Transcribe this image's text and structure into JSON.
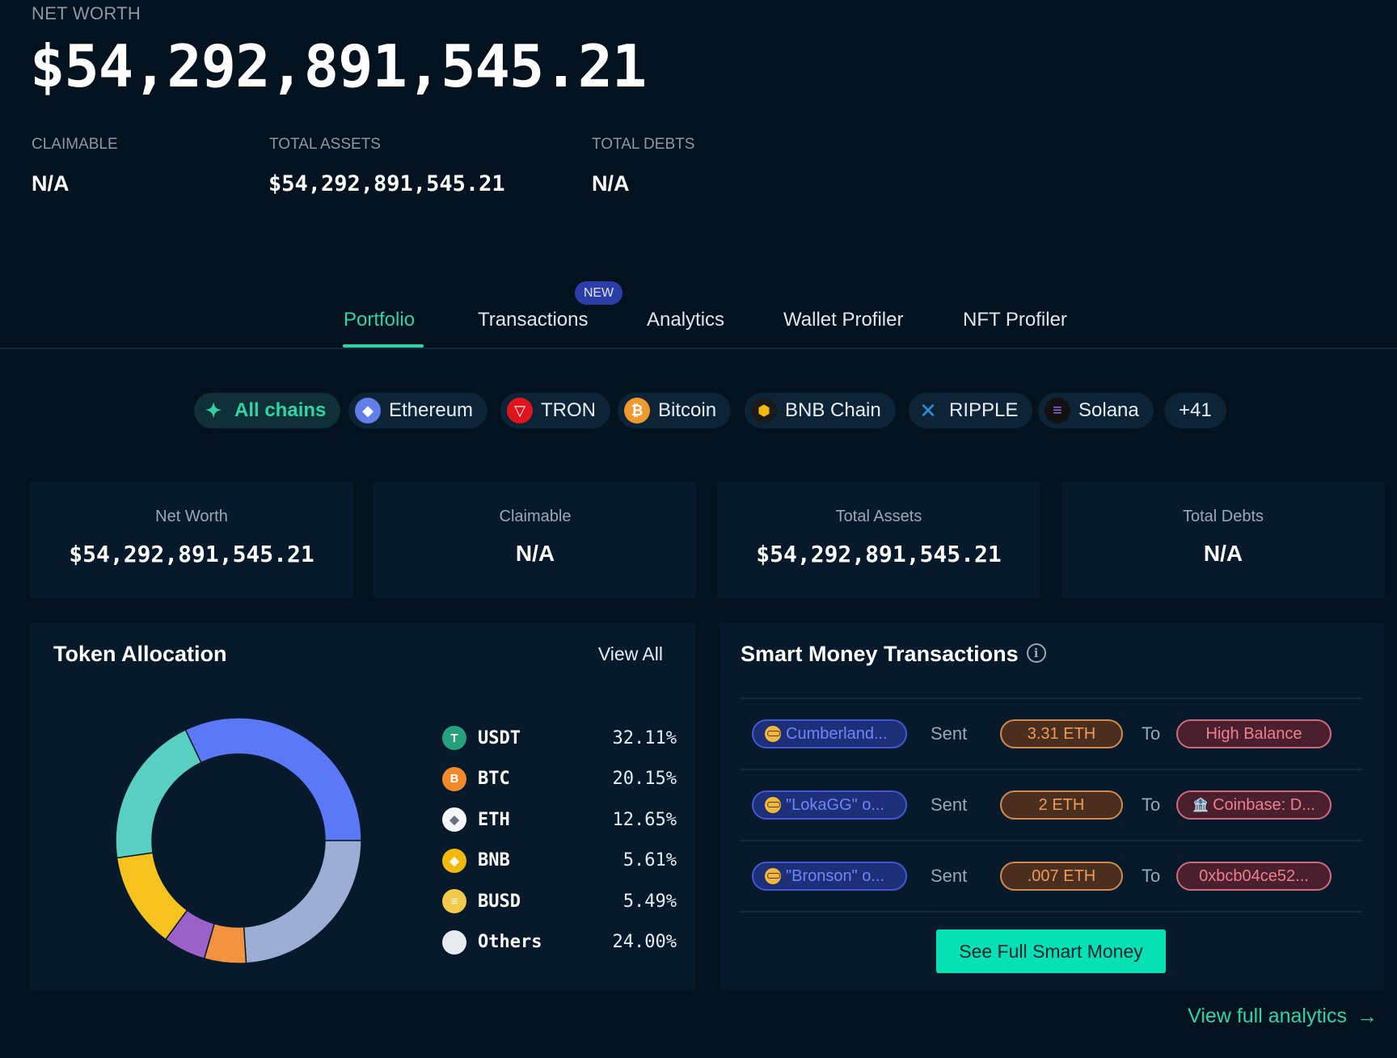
{
  "header": {
    "net_worth_label": "NET WORTH",
    "net_worth_value": "$54,292,891,545.21",
    "claimable_label": "CLAIMABLE",
    "claimable_value": "N/A",
    "total_assets_label": "TOTAL ASSETS",
    "total_assets_value": "$54,292,891,545.21",
    "total_debts_label": "TOTAL DEBTS",
    "total_debts_value": "N/A"
  },
  "tabs": [
    {
      "label": "Portfolio",
      "active": true
    },
    {
      "label": "Transactions",
      "badge": "NEW"
    },
    {
      "label": "Analytics"
    },
    {
      "label": "Wallet Profiler"
    },
    {
      "label": "NFT Profiler"
    }
  ],
  "chains": [
    {
      "label": "All chains",
      "icon": "sparkle-icon",
      "active": true
    },
    {
      "label": "Ethereum",
      "icon": "ethereum-icon"
    },
    {
      "label": "TRON",
      "icon": "tron-icon"
    },
    {
      "label": "Bitcoin",
      "icon": "bitcoin-icon"
    },
    {
      "label": "BNB Chain",
      "icon": "bnb-chain-icon"
    },
    {
      "label": "RIPPLE",
      "icon": "ripple-icon"
    },
    {
      "label": "Solana",
      "icon": "solana-icon"
    },
    {
      "label": "+41"
    }
  ],
  "stats": [
    {
      "label": "Net Worth",
      "value": "$54,292,891,545.21"
    },
    {
      "label": "Claimable",
      "value": "N/A"
    },
    {
      "label": "Total Assets",
      "value": "$54,292,891,545.21"
    },
    {
      "label": "Total Debts",
      "value": "N/A"
    }
  ],
  "token_allocation": {
    "title": "Token Allocation",
    "view_all": "View All",
    "tokens": [
      {
        "symbol": "USDT",
        "percent": "32.11%",
        "value": 32.11,
        "color": "#5b78f6",
        "icon_color": "#26a17b",
        "glyph": "T"
      },
      {
        "symbol": "BTC",
        "percent": "20.15%",
        "value": 20.15,
        "color": "#59d0c2",
        "icon_color": "#f08a2c",
        "glyph": "B"
      },
      {
        "symbol": "ETH",
        "percent": "12.65%",
        "value": 12.65,
        "color": "#f6c21e",
        "icon_color": "#f4f6f8",
        "glyph": "◆"
      },
      {
        "symbol": "BNB",
        "percent": "5.61%",
        "value": 5.61,
        "color": "#9a61c8",
        "icon_color": "#f0b90b",
        "glyph": "◈"
      },
      {
        "symbol": "BUSD",
        "percent": "5.49%",
        "value": 5.49,
        "color": "#f39340",
        "icon_color": "#f3c94a",
        "glyph": "≡"
      },
      {
        "symbol": "Others",
        "percent": "24.00%",
        "value": 24.0,
        "color": "#9caed3",
        "icon_color": "#e8ebee",
        "glyph": ""
      }
    ]
  },
  "smart_money": {
    "title": "Smart Money Transactions",
    "sent_label": "Sent",
    "to_label": "To",
    "rows": [
      {
        "from": "Cumberland...",
        "amount": "3.31 ETH",
        "to": "High Balance"
      },
      {
        "from": "\"LokaGG\" o...",
        "amount": "2 ETH",
        "to": "Coinbase: D..."
      },
      {
        "from": "\"Bronson\" o...",
        "amount": ".007 ETH",
        "to": "0xbcb04ce52..."
      }
    ],
    "cta": "See Full Smart Money"
  },
  "footer": {
    "view_full_analytics": "View full analytics",
    "arrow": "→"
  },
  "chart_data": {
    "type": "pie",
    "title": "Token Allocation",
    "categories": [
      "USDT",
      "BTC",
      "ETH",
      "BNB",
      "BUSD",
      "Others"
    ],
    "values": [
      32.11,
      20.15,
      12.65,
      5.61,
      5.49,
      24.0
    ],
    "colors": [
      "#5b78f6",
      "#59d0c2",
      "#f6c21e",
      "#9a61c8",
      "#f39340",
      "#9caed3"
    ],
    "donut": true,
    "legend": "right"
  }
}
